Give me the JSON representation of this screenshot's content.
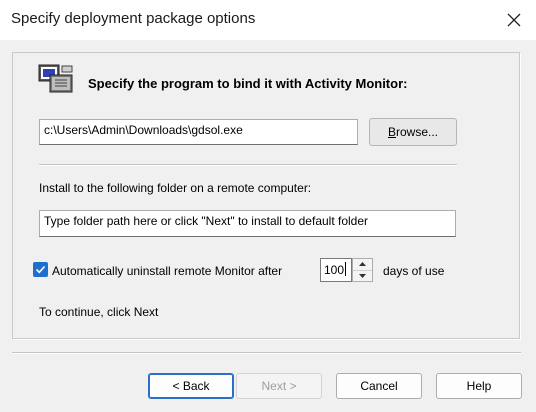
{
  "window": {
    "title": "Specify deployment package options",
    "close_icon": "close-icon"
  },
  "heading": "Specify the program to bind it with Activity Monitor:",
  "program_path": "c:\\Users\\Admin\\Downloads\\gdsol.exe",
  "browse_button": {
    "label_accel": "B",
    "label_rest": "rowse..."
  },
  "install_label": "Install to the following folder on a remote computer:",
  "folder_input_value": "Type folder path here or click \"Next\" to install to default folder",
  "auto_uninstall": {
    "checked": true,
    "label": "Automatically uninstall remote Monitor after",
    "days_value": "100",
    "days_suffix": "days of use"
  },
  "continue_text": "To continue, click Next",
  "buttons": {
    "back": "< Back",
    "next": "Next >",
    "cancel": "Cancel",
    "help": "Help"
  },
  "colors": {
    "checkbox_accent": "#1f6fcf",
    "default_button_border": "#2b6fc9"
  }
}
